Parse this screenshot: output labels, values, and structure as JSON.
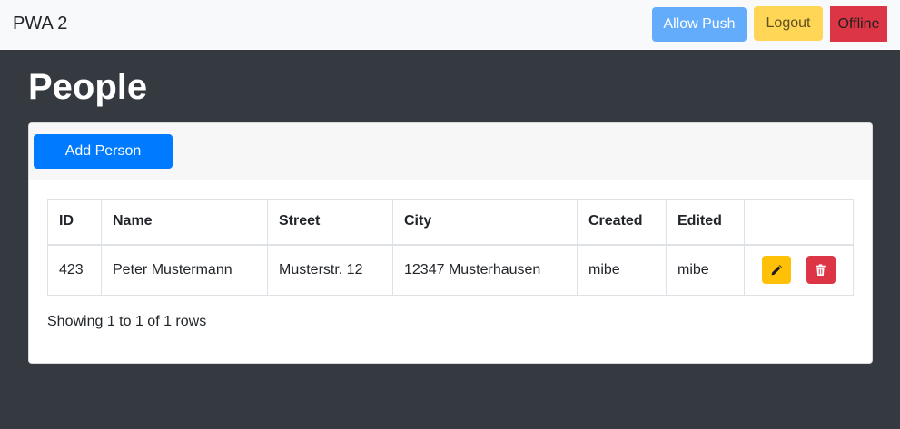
{
  "navbar": {
    "brand": "PWA 2",
    "allow_push_label": "Allow Push",
    "logout_label": "Logout",
    "offline_label": "Offline"
  },
  "page": {
    "title": "People"
  },
  "card": {
    "add_person_label": "Add Person",
    "table": {
      "headers": [
        "ID",
        "Name",
        "Street",
        "City",
        "Created",
        "Edited",
        ""
      ],
      "rows": [
        {
          "id": "423",
          "name": "Peter Mustermann",
          "street": "Musterstr. 12",
          "city": "12347 Musterhausen",
          "created": "mibe",
          "edited": "mibe",
          "actions": [
            "pencil-icon",
            "trash-icon"
          ]
        }
      ]
    },
    "footer": "Showing 1 to 1 of 1 rows"
  },
  "colors": {
    "primary": "#007bff",
    "info_light": "#62acfb",
    "warning": "#ffc107",
    "danger": "#dc3545",
    "dark_bg": "#343a40"
  }
}
